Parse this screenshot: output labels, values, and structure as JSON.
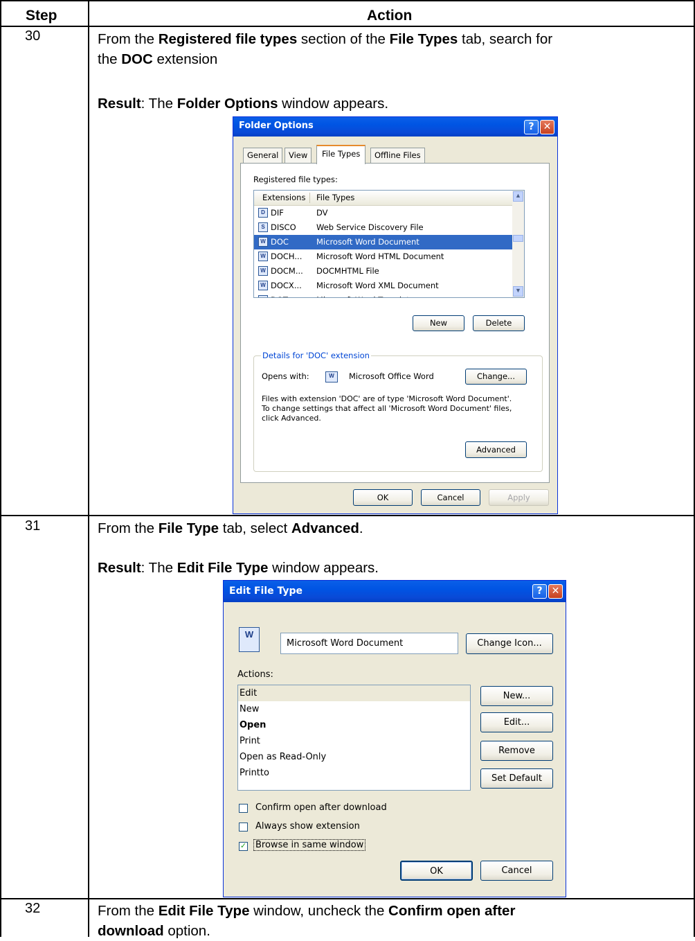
{
  "table": {
    "col_step": "Step",
    "col_action": "Action"
  },
  "steps": [
    {
      "number": "30",
      "line1_a": "From the ",
      "line1_b": "Registered file types",
      "line1_c": " section of the ",
      "line1_d": "File Types",
      "line1_e": " tab, search for",
      "line2_a": "the ",
      "line2_b": "DOC",
      "line2_c": " extension",
      "result_label": "Result",
      "result_a": ":  The ",
      "result_b": "Folder Options",
      "result_c": " window appears."
    },
    {
      "number": "31",
      "line1_a": "From the ",
      "line1_b": "File Type",
      "line1_c": " tab, select ",
      "line1_d": "Advanced",
      "line1_e": ".",
      "result_label": "Result",
      "result_a": ":  The ",
      "result_b": "Edit File Type",
      "result_c": " window appears."
    },
    {
      "number": "32",
      "line1_a": "From the ",
      "line1_b": "Edit File Type",
      "line1_c": " window, uncheck the ",
      "line1_d": "Confirm open after",
      "line2_a": "download",
      "line2_b": " option."
    }
  ],
  "folder_options": {
    "title": "Folder Options",
    "help": "?",
    "close": "✕",
    "tabs": [
      "General",
      "View",
      "File Types",
      "Offline Files"
    ],
    "registered_label": "Registered file types:",
    "col_ext": "Extensions",
    "col_type": "File Types",
    "rows": [
      {
        "ext": "DIF",
        "type": "DV"
      },
      {
        "ext": "DISCO",
        "type": "Web Service Discovery File"
      },
      {
        "ext": "DOC",
        "type": "Microsoft Word Document"
      },
      {
        "ext": "DOCH...",
        "type": "Microsoft Word HTML Document"
      },
      {
        "ext": "DOCM...",
        "type": "DOCMHTML File"
      },
      {
        "ext": "DOCX...",
        "type": "Microsoft Word XML Document"
      },
      {
        "ext": "DOT",
        "type": "Microsoft Word Template"
      }
    ],
    "btn_new": "New",
    "btn_delete": "Delete",
    "details_label": "Details for 'DOC' extension",
    "opens_with_label": "Opens with:",
    "opens_with_value": "Microsoft Office Word",
    "btn_change": "Change...",
    "desc_1": "Files with extension 'DOC' are of type 'Microsoft Word Document'.",
    "desc_2": "To change settings that affect all 'Microsoft Word Document' files,",
    "desc_3": "click Advanced.",
    "btn_advanced": "Advanced",
    "btn_ok": "OK",
    "btn_cancel": "Cancel",
    "btn_apply": "Apply"
  },
  "edit_file_type": {
    "title": "Edit File Type",
    "help": "?",
    "close": "✕",
    "name_value": "Microsoft Word Document",
    "btn_change_icon": "Change Icon...",
    "actions_label": "Actions:",
    "actions": [
      "Edit",
      "New",
      "Open",
      "Print",
      "Open as Read-Only",
      "Printto"
    ],
    "btn_new": "New...",
    "btn_edit": "Edit...",
    "btn_remove": "Remove",
    "btn_set_default": "Set Default",
    "cb_confirm": "Confirm open after download",
    "cb_always": "Always show extension",
    "cb_browse": "Browse in same window",
    "browse_checked": true,
    "btn_ok": "OK",
    "btn_cancel": "Cancel"
  }
}
